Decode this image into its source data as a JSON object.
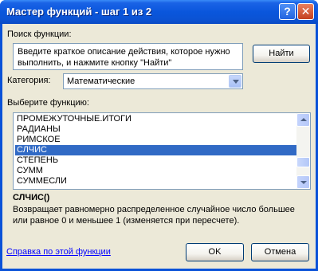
{
  "window": {
    "title": "Мастер функций - шаг 1 из 2",
    "help_glyph": "?",
    "close_glyph": "✕"
  },
  "search": {
    "label": "Поиск функции:",
    "value": "Введите краткое описание действия, которое нужно выполнить, и нажмите кнопку \"Найти\"",
    "find_button": "Найти"
  },
  "category": {
    "label": "Категория:",
    "selected": "Математические"
  },
  "functions": {
    "label": "Выберите функцию:",
    "items": [
      "ПРОМЕЖУТОЧНЫЕ.ИТОГИ",
      "РАДИАНЫ",
      "РИМСКОЕ",
      "СЛЧИС",
      "СТЕПЕНЬ",
      "СУММ",
      "СУММЕСЛИ"
    ],
    "selected_index": 3
  },
  "details": {
    "signature": "СЛЧИС()",
    "description": "Возвращает равномерно распределенное случайное число большее или равное 0 и меньшее 1 (изменяется при пересчете)."
  },
  "footer": {
    "help_link": "Справка по этой функции",
    "ok": "OK",
    "cancel": "Отмена"
  },
  "colors": {
    "title_bar": "#0a56dc",
    "dialog_bg": "#ece9d8",
    "selection": "#316ac5",
    "link": "#0000ff"
  }
}
